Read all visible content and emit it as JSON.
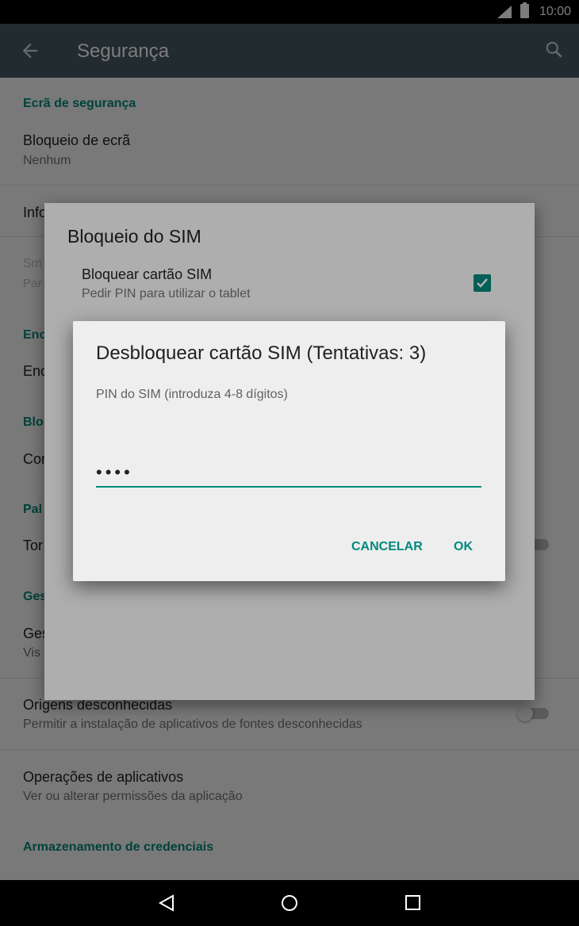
{
  "status_bar": {
    "time": "10:00",
    "icons": [
      "signal-icon",
      "battery-icon"
    ]
  },
  "app_bar": {
    "title": "Segurança",
    "back_icon": "back-arrow-icon",
    "search_icon": "search-icon"
  },
  "settings": {
    "screen_security_header": "Ecrã de segurança",
    "screen_lock_title": "Bloqueio de ecrã",
    "screen_lock_value": "Nenhum",
    "owner_info_partial": "Info",
    "smart_lock_partial": "Sm",
    "smart_lock_sub_partial": "Par",
    "encryption_header_partial": "Enc",
    "encrypt_item_partial": "Enc",
    "sim_lock_header_partial": "Blo",
    "sim_lock_item_partial": "Cor",
    "passwords_header_partial": "Pal",
    "show_passwords_partial": "Tor",
    "device_admin_header_partial": "Ges",
    "device_admin_item_partial": "Ges",
    "device_admin_sub_partial": "Vis",
    "unknown_sources_title": "Origens desconhecidas",
    "unknown_sources_sub": "Permitir a instalação de aplicativos de fontes desconhecidas",
    "app_ops_title": "Operações de aplicativos",
    "app_ops_sub": "Ver ou alterar permissões da aplicação",
    "credential_storage_header": "Armazenamento de credenciais"
  },
  "sim_lock_dialog": {
    "title": "Bloqueio do SIM",
    "option_title": "Bloquear cartão SIM",
    "option_sub": "Pedir PIN para utilizar o tablet",
    "option_checked": true
  },
  "unlock_dialog": {
    "title": "Desbloquear cartão SIM (Tentativas: 3)",
    "prompt": "PIN do SIM (introduza 4-8 dígitos)",
    "pin_value": "••••",
    "cancel_label": "CANCELAR",
    "ok_label": "OK"
  },
  "colors": {
    "accent": "#00897b",
    "app_bar": "#455a64"
  }
}
